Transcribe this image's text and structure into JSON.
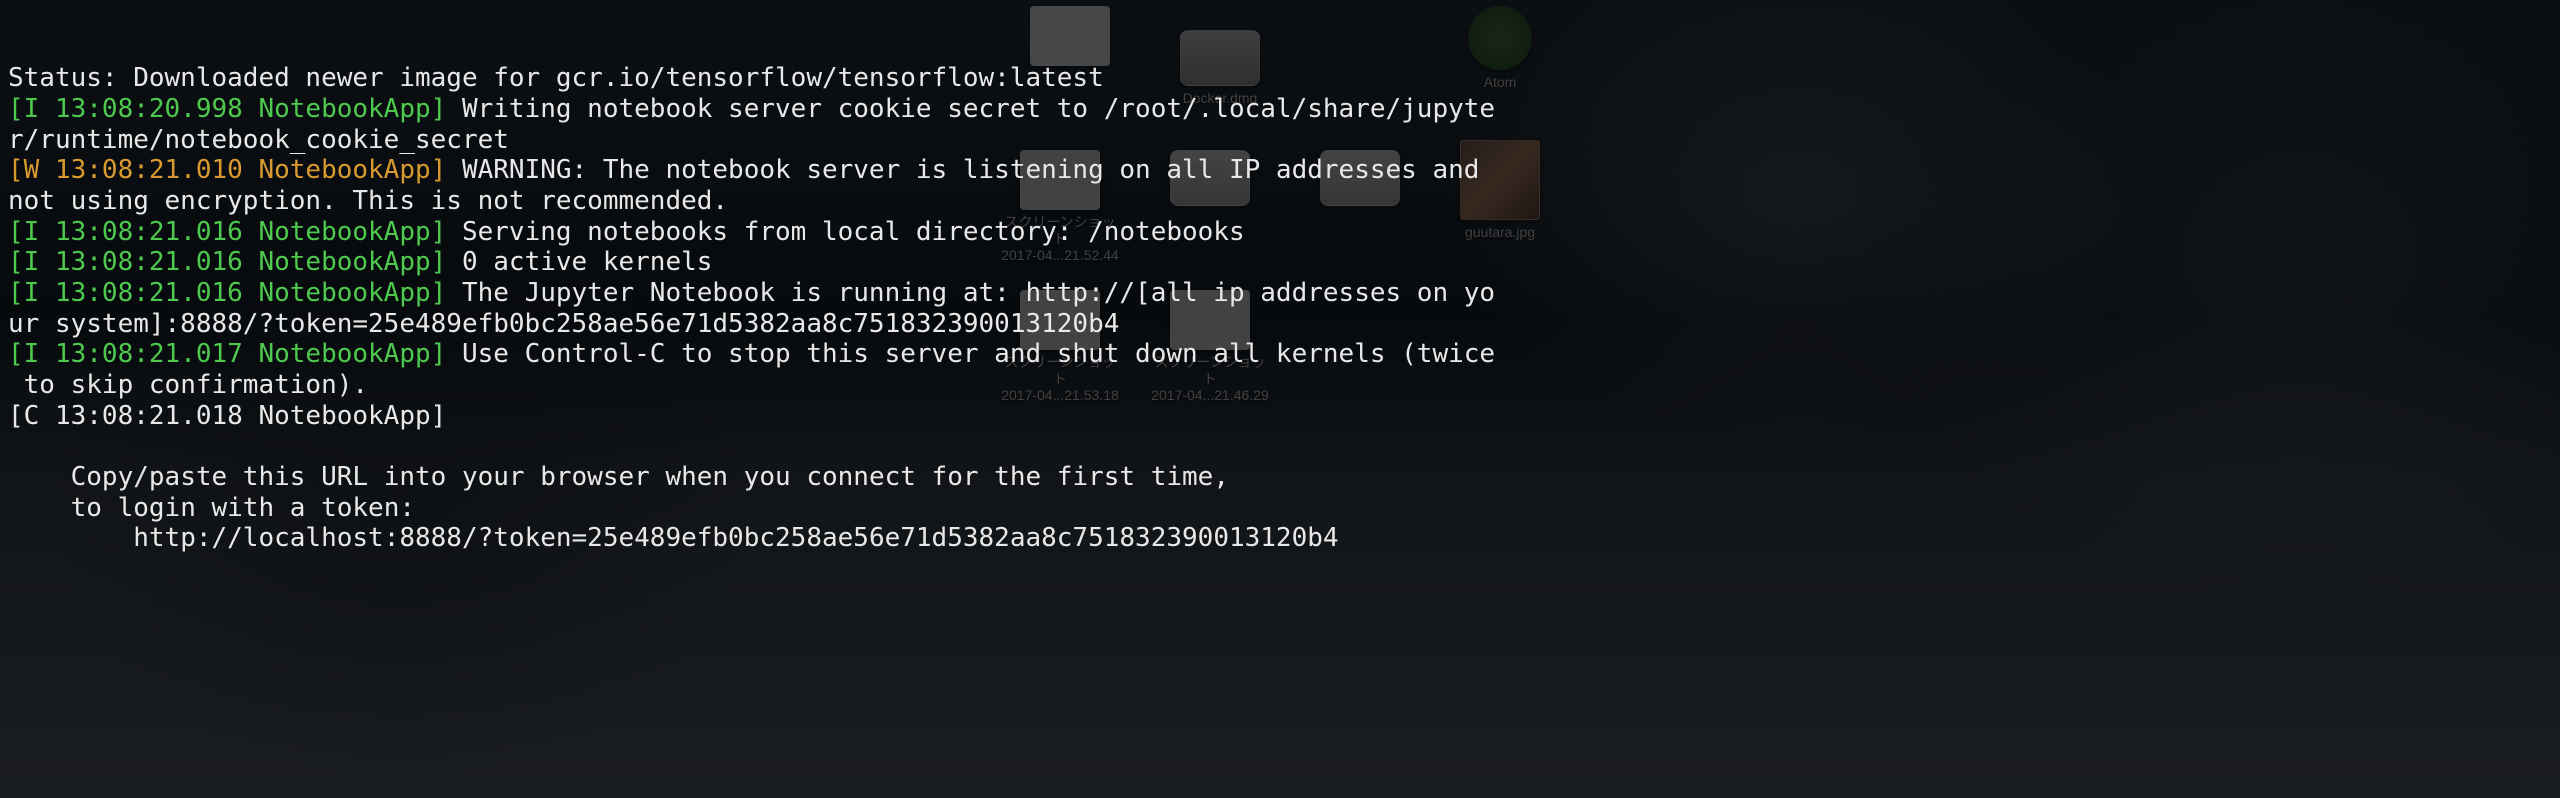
{
  "desktop": {
    "icons": [
      {
        "name": "desk-item-1",
        "pos": "top-right-1",
        "kind": "white",
        "label": ""
      },
      {
        "name": "desk-item-2",
        "pos": "top-right-2",
        "kind": "docker",
        "label": "Docker.dmg"
      },
      {
        "name": "desk-item-atom",
        "pos": "top-right-3",
        "kind": "atom",
        "label": "Atom"
      },
      {
        "name": "desk-item-ss1",
        "pos": "row2-1",
        "kind": "gray",
        "label": "スクリーンショット"
      },
      {
        "name": "desk-item-disk1",
        "pos": "row2-2",
        "kind": "disk",
        "label": ""
      },
      {
        "name": "desk-item-disk2",
        "pos": "row2-3",
        "kind": "disk",
        "label": ""
      },
      {
        "name": "desk-item-photo",
        "pos": "row2-4",
        "kind": "photo",
        "label": "guutara.jpg"
      },
      {
        "name": "desk-item-time1",
        "pos": "label-1",
        "kind": "none",
        "label": "2017-04...21.52.44"
      },
      {
        "name": "desk-item-ss2",
        "pos": "row3-1",
        "kind": "gray",
        "label": "スクリーンショット\n2017-04...21.53.18"
      },
      {
        "name": "desk-item-ss3",
        "pos": "row3-2",
        "kind": "gray",
        "label": "スクリーンショット\n2017-04...21.46.29"
      }
    ]
  },
  "terminal": {
    "lines": [
      {
        "type": "plain",
        "prefix": "",
        "body": "Status: Downloaded newer image for gcr.io/tensorflow/tensorflow:latest"
      },
      {
        "type": "info",
        "prefix": "[I 13:08:20.998 NotebookApp]",
        "body": " Writing notebook server cookie secret to /root/.local/share/jupyter/runtime/notebook_cookie_secret"
      },
      {
        "type": "warn",
        "prefix": "[W 13:08:21.010 NotebookApp]",
        "body": " WARNING: The notebook server is listening on all IP addresses and not using encryption. This is not recommended."
      },
      {
        "type": "info",
        "prefix": "[I 13:08:21.016 NotebookApp]",
        "body": " Serving notebooks from local directory: /notebooks"
      },
      {
        "type": "info",
        "prefix": "[I 13:08:21.016 NotebookApp]",
        "body": " 0 active kernels "
      },
      {
        "type": "info",
        "prefix": "[I 13:08:21.016 NotebookApp]",
        "body": " The Jupyter Notebook is running at: http://[all ip addresses on your system]:8888/?token=25e489efb0bc258ae56e71d5382aa8c751832390013120b4"
      },
      {
        "type": "info",
        "prefix": "[I 13:08:21.017 NotebookApp]",
        "body": " Use Control-C to stop this server and shut down all kernels (twice to skip confirmation)."
      },
      {
        "type": "crit",
        "prefix": "[C 13:08:21.018 NotebookApp]",
        "body": " "
      },
      {
        "type": "plain",
        "prefix": "",
        "body": "    "
      },
      {
        "type": "plain",
        "prefix": "",
        "body": "    Copy/paste this URL into your browser when you connect for the first time,"
      },
      {
        "type": "plain",
        "prefix": "",
        "body": "    to login with a token:"
      },
      {
        "type": "plain",
        "prefix": "",
        "body": "        http://localhost:8888/?token=25e489efb0bc258ae56e71d5382aa8c751832390013120b4"
      }
    ]
  }
}
